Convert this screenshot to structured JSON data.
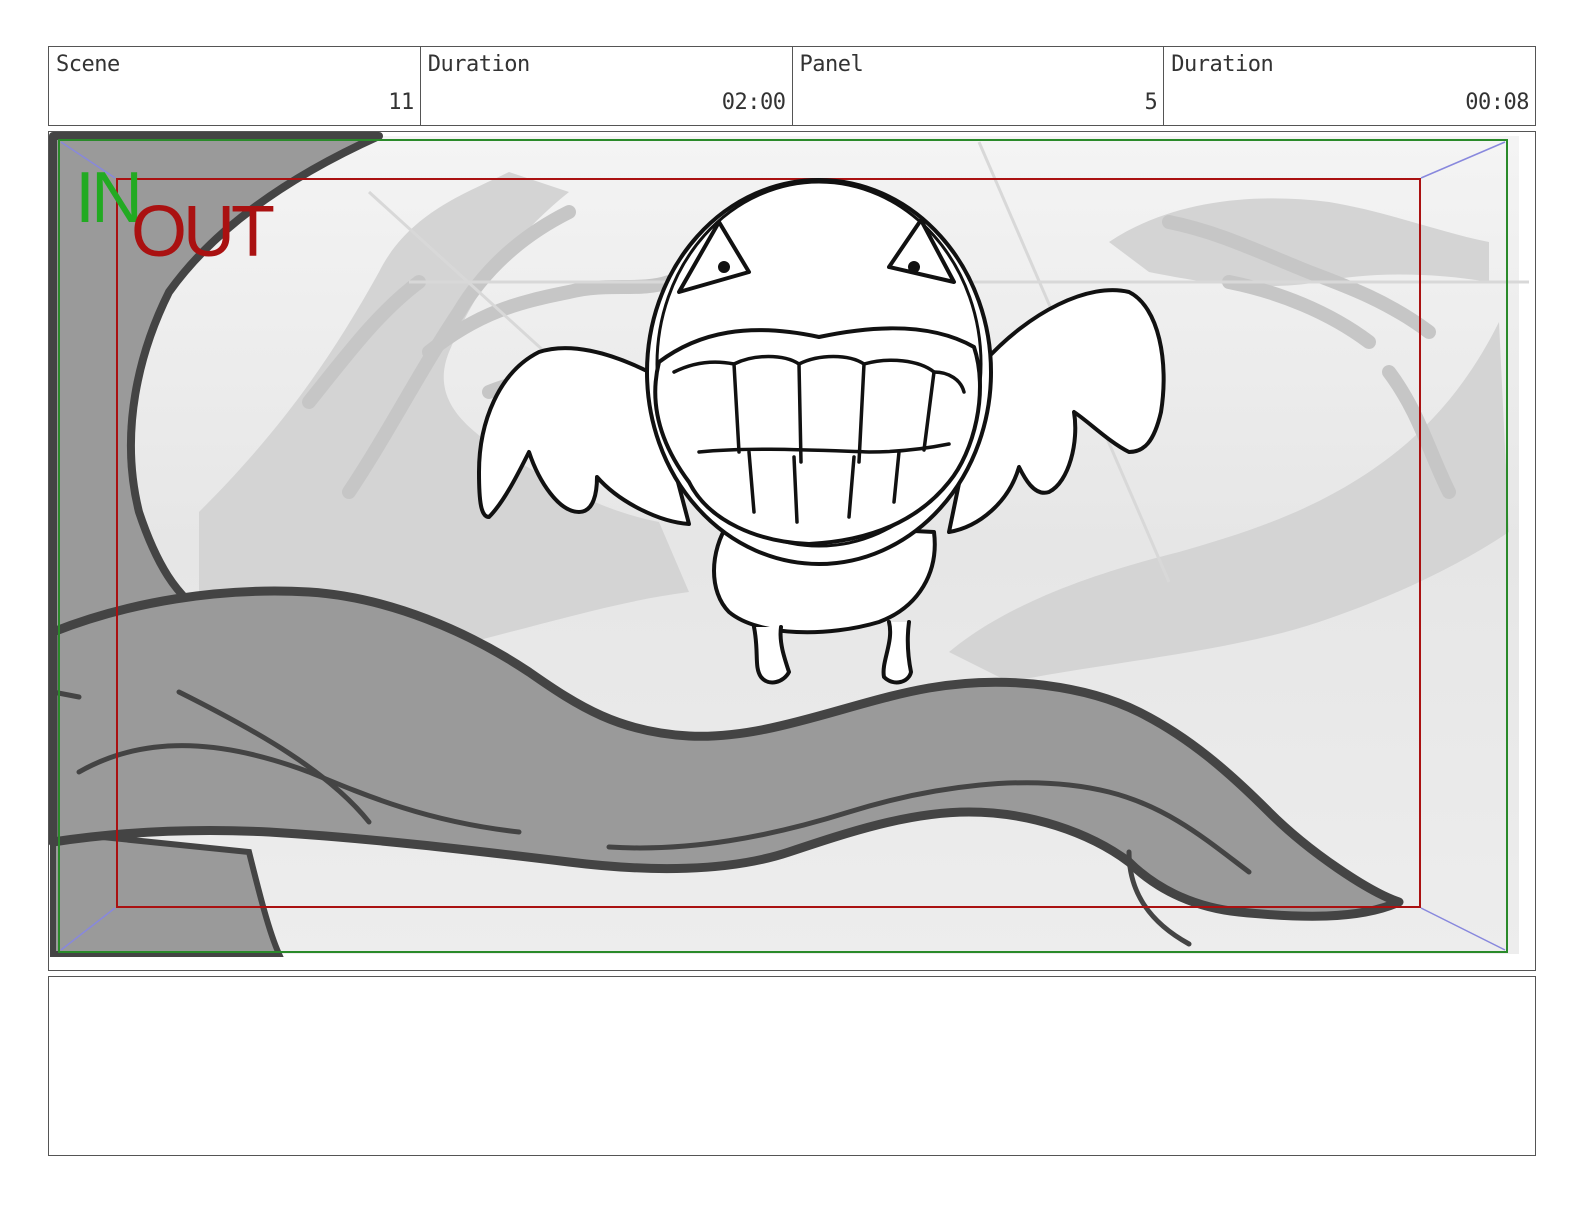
{
  "header": {
    "scene_label": "Scene",
    "scene_value": "11",
    "duration1_label": "Duration",
    "duration1_value": "02:00",
    "panel_label": "Panel",
    "panel_value": "5",
    "duration2_label": "Duration",
    "duration2_value": "00:08"
  },
  "frame": {
    "in_text": "IN",
    "out_text": "OUT",
    "in_color": "#22aa22",
    "out_color": "#aa1111"
  },
  "notes": {
    "text": ""
  }
}
